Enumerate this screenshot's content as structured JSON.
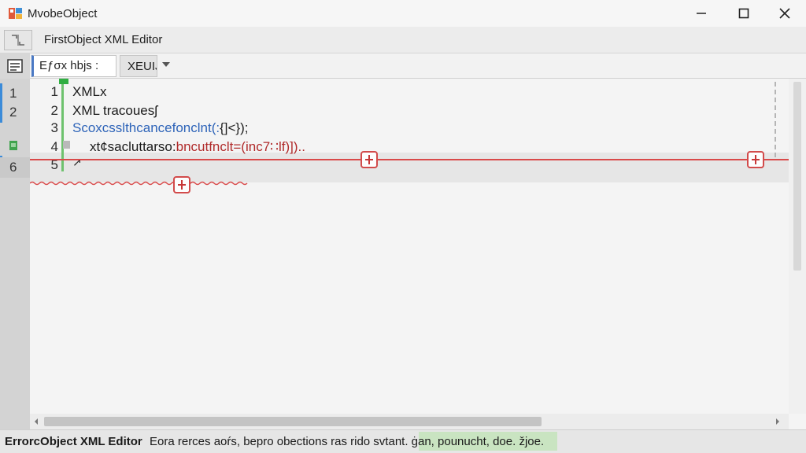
{
  "window": {
    "title": "MvobeObject",
    "icons": {
      "app": "app-logo-icon",
      "minimize": "minimize-icon",
      "maximize": "maximize-icon",
      "close": "close-icon"
    }
  },
  "header": {
    "doc_title": "FirstObject XML Editor",
    "icon": "layout-toggle-icon"
  },
  "toolbar": {
    "menu_icon": "document-list-icon",
    "field_value": "Eƒσx hbjs :",
    "dropdown_value": "XEUIJ",
    "dropdown_icon": "chevron-down-icon"
  },
  "gutter": {
    "numbers": [
      "1",
      "2",
      "",
      "",
      "6"
    ]
  },
  "editor": {
    "lines": [
      {
        "num": "1",
        "text": "XMLx"
      },
      {
        "num": "2",
        "text": "XML tracouesʃ"
      },
      {
        "num": "3",
        "prefix": "Scoxcsslthcancefonclnt(:",
        "suffix": "{]<});"
      },
      {
        "num": "4",
        "prefix": "xt¢sacluttarso:",
        "suffix": "bncutfnclt=(inc7∷lf)]).."
      },
      {
        "num": "5",
        "text": "↗"
      }
    ],
    "error_color": "#d94a4a",
    "accent_color": "#2d63b8",
    "gutter_accent": "#6ec26e"
  },
  "status": {
    "app_name": "ErrorcObject XML Editor",
    "message": "Eora rerces aoŕs, bepro obections ras rido svtant. ġan, pounucht, doe. žjoe."
  }
}
